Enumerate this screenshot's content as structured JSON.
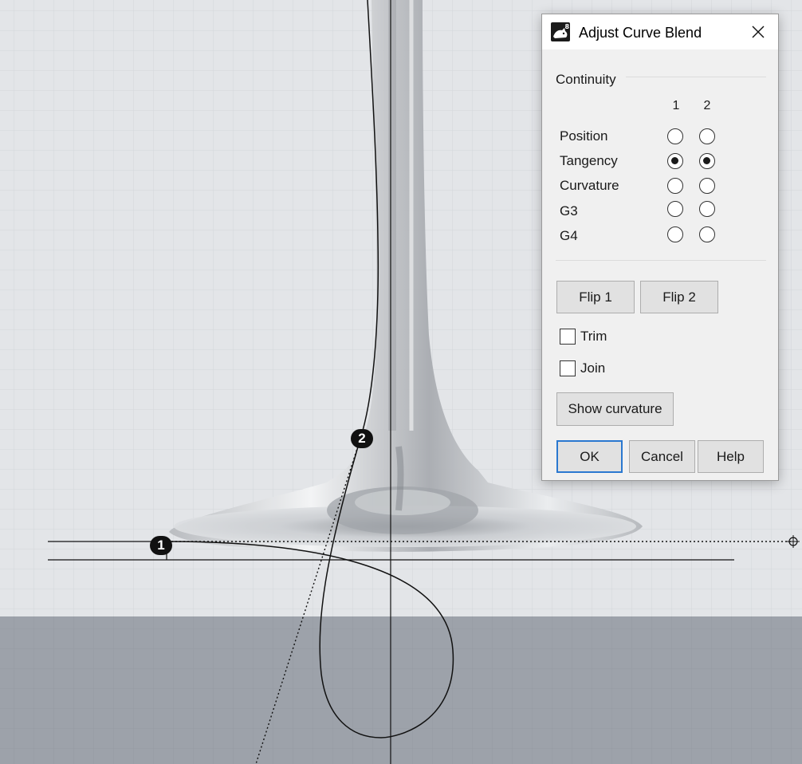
{
  "dialog": {
    "title": "Adjust Curve Blend",
    "app_icon": "rhino-8-icon",
    "continuity": {
      "label": "Continuity",
      "columns": [
        "1",
        "2"
      ],
      "rows": [
        {
          "label": "Position",
          "col1": false,
          "col2": false
        },
        {
          "label": "Tangency",
          "col1": true,
          "col2": true
        },
        {
          "label": "Curvature",
          "col1": false,
          "col2": false
        },
        {
          "label": "G3",
          "col1": false,
          "col2": false
        },
        {
          "label": "G4",
          "col1": false,
          "col2": false
        }
      ]
    },
    "flip1_label": "Flip 1",
    "flip2_label": "Flip 2",
    "trim": {
      "label": "Trim",
      "checked": false
    },
    "join": {
      "label": "Join",
      "checked": false
    },
    "show_curvature_label": "Show curvature",
    "ok_label": "OK",
    "cancel_label": "Cancel",
    "help_label": "Help"
  },
  "viewport": {
    "point1_label": "1",
    "point2_label": "2",
    "colors": {
      "background_upper": "#e3e5e8",
      "background_lower": "#9da2aa",
      "curve": "#000000",
      "accent_focus": "#2a78d0"
    }
  }
}
